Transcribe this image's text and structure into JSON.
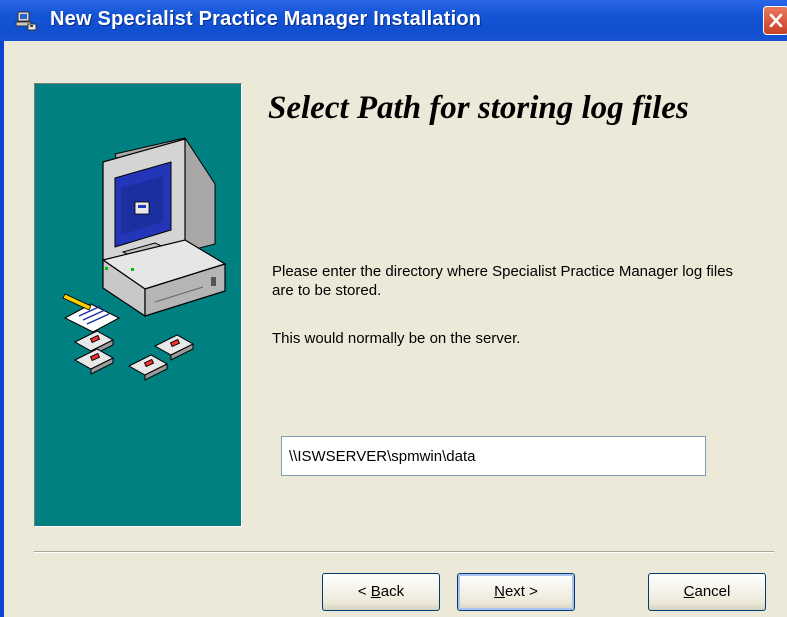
{
  "window": {
    "title": "New Specialist Practice Manager Installation"
  },
  "page": {
    "heading": "Select Path for storing log files",
    "description": "Please enter the directory where Specialist Practice Manager log files are to be stored.",
    "note": "This would normally be on the server."
  },
  "path_input": {
    "value": "\\\\ISWSERVER\\spmwin\\data"
  },
  "buttons": {
    "back": {
      "prefix": "< ",
      "access_key": "B",
      "rest": "ack"
    },
    "next": {
      "access_key": "N",
      "rest": "ext >"
    },
    "cancel": {
      "access_key": "C",
      "rest": "ancel"
    }
  },
  "colors": {
    "side_panel": "#008080",
    "title_bar": "#0f4fd0",
    "close_button": "#d4503a"
  }
}
